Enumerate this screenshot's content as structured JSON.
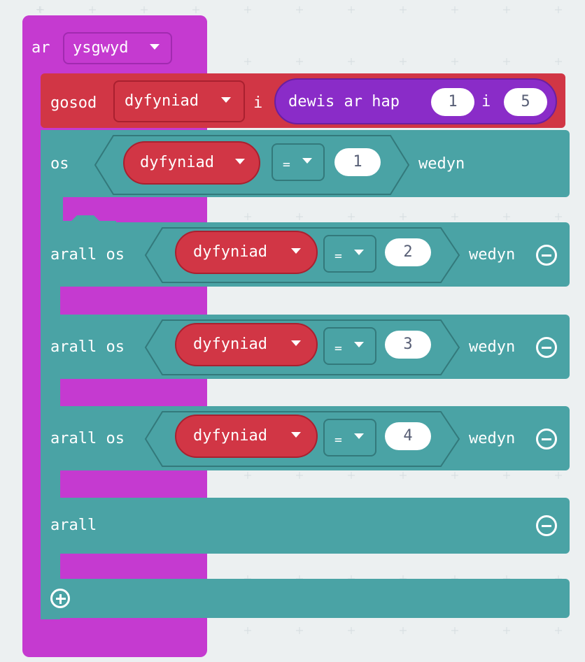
{
  "colors": {
    "event": "#c53ad0",
    "event_dark": "#a12ab0",
    "variable": "#d13645",
    "variable_dark": "#a9202f",
    "math": "#8a2cc8",
    "logic": "#4aa3a5",
    "logic_dark": "#33797b",
    "workspace": "#ecf0f1"
  },
  "event_block": {
    "label": "ar",
    "dropdown": "ysgwyd"
  },
  "set_block": {
    "label": "gosod",
    "variable": "dyfyniad",
    "to": "i",
    "random": {
      "label": "dewis ar hap",
      "from": "1",
      "to_word": "i",
      "to": "5"
    }
  },
  "if_block": {
    "if_label": "os",
    "else_if_label": "arall os",
    "then_label": "wedyn",
    "else_label": "arall",
    "operator": "=",
    "variable": "dyfyniad",
    "conditions": [
      "1",
      "2",
      "3",
      "4"
    ],
    "remove_icon": "minus-circle-icon",
    "add_icon": "plus-circle-icon"
  }
}
